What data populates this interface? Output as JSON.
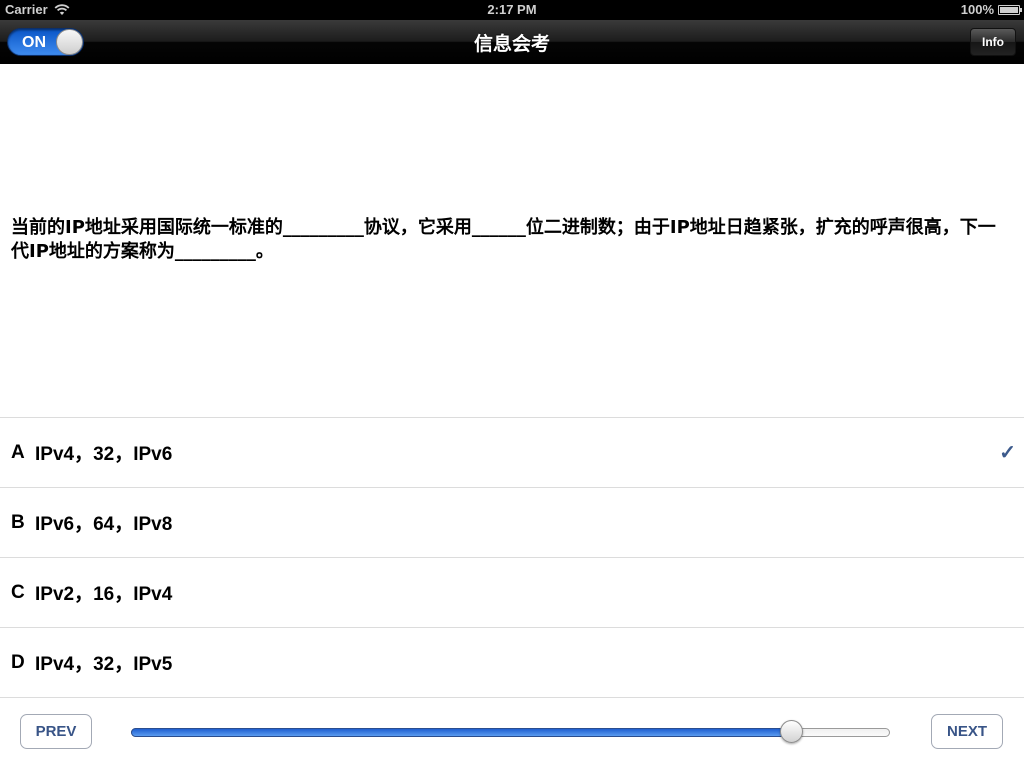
{
  "status_bar": {
    "carrier": "Carrier",
    "time": "2:17 PM",
    "battery": "100%",
    "battery_level": 1.0
  },
  "nav": {
    "title": "信息会考",
    "toggle_label": "ON",
    "toggle_on": true,
    "info_label": "Info"
  },
  "question": {
    "text": "当前的IP地址采用国际统一标准的_________协议，它采用______位二进制数；由于IP地址日趋紧张，扩充的呼声很高，下一代IP地址的方案称为_________。"
  },
  "options": [
    {
      "letter": "A",
      "text": "IPv4，32，IPv6",
      "selected": true
    },
    {
      "letter": "B",
      "text": "IPv6，64，IPv8",
      "selected": false
    },
    {
      "letter": "C",
      "text": "IPv2，16，IPv4",
      "selected": false
    },
    {
      "letter": "D",
      "text": "IPv4，32，IPv5",
      "selected": false
    }
  ],
  "checkmark": "✓",
  "footer": {
    "prev_label": "PREV",
    "next_label": "NEXT",
    "progress": 0.87
  },
  "colors": {
    "accent_blue": "#2f6fd8",
    "button_text": "#385487",
    "check_color": "#3c5a8c"
  }
}
